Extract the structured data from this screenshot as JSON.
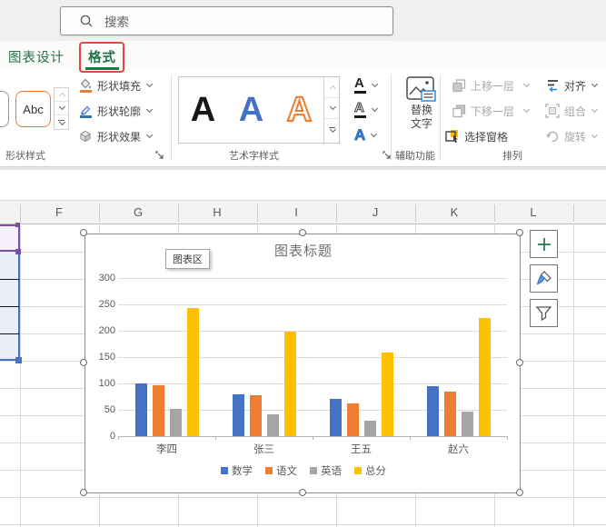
{
  "topbar": {
    "search_placeholder": "搜索"
  },
  "tabs": {
    "chart_design": "图表设计",
    "format": "格式"
  },
  "ribbon": {
    "shape_styles": {
      "sample": "Abc",
      "fill": "形状填充",
      "outline": "形状轮廓",
      "effects": "形状效果",
      "group_label": "形状样式"
    },
    "wordart": {
      "samples": [
        "A",
        "A",
        "A"
      ],
      "group_label": "艺术字样式"
    },
    "accessibility": {
      "alt_text_line1": "替换",
      "alt_text_line2": "文字",
      "group_label": "辅助功能"
    },
    "arrange": {
      "bring_forward": "上移一层",
      "send_backward": "下移一层",
      "selection_pane": "选择窗格",
      "align": "对齐",
      "group": "组合",
      "rotate": "旋转",
      "group_label": "排列"
    }
  },
  "sheet": {
    "columns": [
      "F",
      "G",
      "H",
      "I",
      "J",
      "K",
      "L"
    ]
  },
  "chart": {
    "tooltip": "图表区"
  },
  "chart_data": {
    "type": "bar",
    "title": "图表标题",
    "categories": [
      "李四",
      "张三",
      "王五",
      "赵六"
    ],
    "series": [
      {
        "name": "数学",
        "color": "#4472C4",
        "values": [
          100,
          80,
          70,
          95
        ]
      },
      {
        "name": "语文",
        "color": "#ED7D31",
        "values": [
          96,
          78,
          62,
          85
        ]
      },
      {
        "name": "英语",
        "color": "#A5A5A5",
        "values": [
          51,
          42,
          30,
          46
        ]
      },
      {
        "name": "总分",
        "color": "#FFC000",
        "values": [
          243,
          199,
          158,
          225
        ]
      }
    ],
    "xlabel": "",
    "ylabel": "",
    "ylim": [
      0,
      300
    ],
    "ytick_step": 50,
    "grid": true,
    "legend_position": "bottom"
  }
}
